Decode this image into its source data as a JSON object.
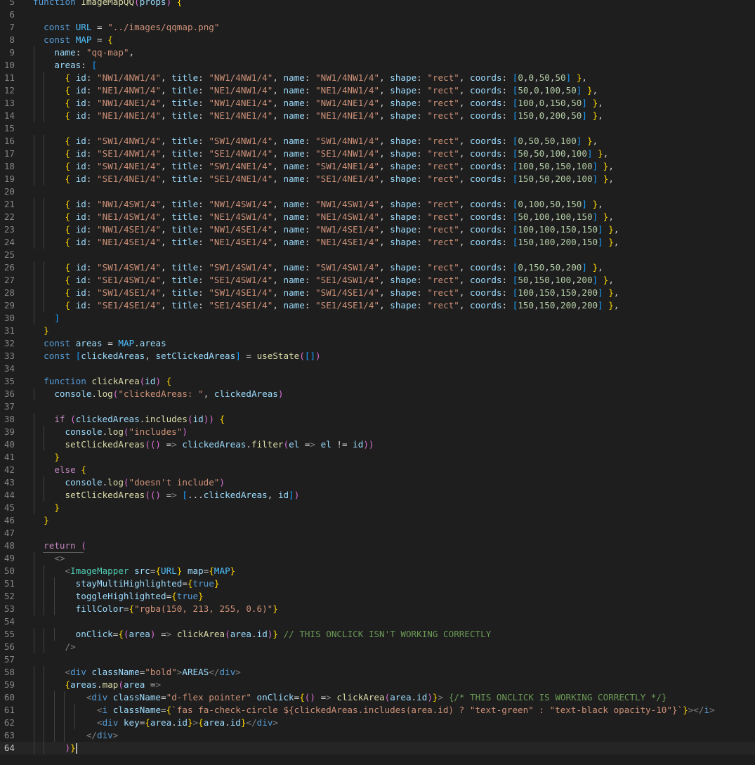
{
  "editor": {
    "language": "javascript-react",
    "current_line": 64,
    "colors": {
      "background": "#1e1e1e",
      "keyword": "#569cd6",
      "control": "#c586c0",
      "function": "#dcdcaa",
      "variable": "#9cdcfe",
      "constant": "#4fc1ff",
      "string": "#ce9178",
      "number": "#b5cea8",
      "comment": "#6a9955",
      "component": "#4ec9b0",
      "line_number": "#858585"
    },
    "lines": [
      {
        "n": "5",
        "text": "function ImageMapQQ(props) {"
      },
      {
        "n": "6",
        "text": ""
      },
      {
        "n": "7",
        "text": "  const URL = \"../images/qqmap.png\""
      },
      {
        "n": "8",
        "text": "  const MAP = {"
      },
      {
        "n": "9",
        "text": "    name: \"qq-map\","
      },
      {
        "n": "10",
        "text": "    areas: ["
      },
      {
        "n": "11",
        "text": "      { id: \"NW1/4NW1/4\", title: \"NW1/4NW1/4\", name: \"NW1/4NW1/4\", shape: \"rect\", coords: [0,0,50,50] },"
      },
      {
        "n": "12",
        "text": "      { id: \"NE1/4NW1/4\", title: \"NE1/4NW1/4\", name: \"NE1/4NW1/4\", shape: \"rect\", coords: [50,0,100,50] },"
      },
      {
        "n": "13",
        "text": "      { id: \"NW1/4NE1/4\", title: \"NW1/4NE1/4\", name: \"NW1/4NE1/4\", shape: \"rect\", coords: [100,0,150,50] },"
      },
      {
        "n": "14",
        "text": "      { id: \"NE1/4NE1/4\", title: \"NE1/4NE1/4\", name: \"NE1/4NE1/4\", shape: \"rect\", coords: [150,0,200,50] },"
      },
      {
        "n": "15",
        "text": ""
      },
      {
        "n": "16",
        "text": "      { id: \"SW1/4NW1/4\", title: \"SW1/4NW1/4\", name: \"SW1/4NW1/4\", shape: \"rect\", coords: [0,50,50,100] },"
      },
      {
        "n": "17",
        "text": "      { id: \"SE1/4NW1/4\", title: \"SE1/4NW1/4\", name: \"SE1/4NW1/4\", shape: \"rect\", coords: [50,50,100,100] },"
      },
      {
        "n": "18",
        "text": "      { id: \"SW1/4NE1/4\", title: \"SW1/4NE1/4\", name: \"SW1/4NE1/4\", shape: \"rect\", coords: [100,50,150,100] },"
      },
      {
        "n": "19",
        "text": "      { id: \"SE1/4NE1/4\", title: \"SE1/4NE1/4\", name: \"SE1/4NE1/4\", shape: \"rect\", coords: [150,50,200,100] },"
      },
      {
        "n": "20",
        "text": ""
      },
      {
        "n": "21",
        "text": "      { id: \"NW1/4SW1/4\", title: \"NW1/4SW1/4\", name: \"NW1/4SW1/4\", shape: \"rect\", coords: [0,100,50,150] },"
      },
      {
        "n": "22",
        "text": "      { id: \"NE1/4SW1/4\", title: \"NE1/4SW1/4\", name: \"NE1/4SW1/4\", shape: \"rect\", coords: [50,100,100,150] },"
      },
      {
        "n": "23",
        "text": "      { id: \"NW1/4SE1/4\", title: \"NW1/4SE1/4\", name: \"NW1/4SE1/4\", shape: \"rect\", coords: [100,100,150,150] },"
      },
      {
        "n": "24",
        "text": "      { id: \"NE1/4SE1/4\", title: \"NE1/4SE1/4\", name: \"NE1/4SE1/4\", shape: \"rect\", coords: [150,100,200,150] },"
      },
      {
        "n": "25",
        "text": ""
      },
      {
        "n": "26",
        "text": "      { id: \"SW1/4SW1/4\", title: \"SW1/4SW1/4\", name: \"SW1/4SW1/4\", shape: \"rect\", coords: [0,150,50,200] },"
      },
      {
        "n": "27",
        "text": "      { id: \"SE1/4SW1/4\", title: \"SE1/4SW1/4\", name: \"SE1/4SW1/4\", shape: \"rect\", coords: [50,150,100,200] },"
      },
      {
        "n": "28",
        "text": "      { id: \"SW1/4SE1/4\", title: \"SW1/4SE1/4\", name: \"SW1/4SE1/4\", shape: \"rect\", coords: [100,150,150,200] },"
      },
      {
        "n": "29",
        "text": "      { id: \"SE1/4SE1/4\", title: \"SE1/4SE1/4\", name: \"SE1/4SE1/4\", shape: \"rect\", coords: [150,150,200,200] },"
      },
      {
        "n": "30",
        "text": "    ]"
      },
      {
        "n": "31",
        "text": "  }"
      },
      {
        "n": "32",
        "text": "  const areas = MAP.areas"
      },
      {
        "n": "33",
        "text": "  const [clickedAreas, setClickedAreas] = useState([])"
      },
      {
        "n": "34",
        "text": ""
      },
      {
        "n": "35",
        "text": "  function clickArea(id) {"
      },
      {
        "n": "36",
        "text": "    console.log(\"clickedAreas: \", clickedAreas)"
      },
      {
        "n": "37",
        "text": ""
      },
      {
        "n": "38",
        "text": "    if (clickedAreas.includes(id)) {"
      },
      {
        "n": "39",
        "text": "      console.log(\"includes\")"
      },
      {
        "n": "40",
        "text": "      setClickedAreas(() => clickedAreas.filter(el => el != id))"
      },
      {
        "n": "41",
        "text": "    }"
      },
      {
        "n": "42",
        "text": "    else {"
      },
      {
        "n": "43",
        "text": "      console.log(\"doesn't include\")"
      },
      {
        "n": "44",
        "text": "      setClickedAreas(() => [...clickedAreas, id])"
      },
      {
        "n": "45",
        "text": "    }"
      },
      {
        "n": "46",
        "text": "  }"
      },
      {
        "n": "47",
        "text": ""
      },
      {
        "n": "48",
        "text": "  return ("
      },
      {
        "n": "49",
        "text": "    <>"
      },
      {
        "n": "50",
        "text": "      <ImageMapper src={URL} map={MAP}"
      },
      {
        "n": "51",
        "text": "        stayMultiHighlighted={true}"
      },
      {
        "n": "52",
        "text": "        toggleHighlighted={true}"
      },
      {
        "n": "53",
        "text": "        fillColor={\"rgba(150, 213, 255, 0.6)\"}"
      },
      {
        "n": "54",
        "text": ""
      },
      {
        "n": "55",
        "text": "        onClick={(area) => clickArea(area.id)} // THIS ONCLICK ISN'T WORKING CORRECTLY"
      },
      {
        "n": "56",
        "text": "      />"
      },
      {
        "n": "57",
        "text": ""
      },
      {
        "n": "58",
        "text": "      <div className=\"bold\">AREAS</div>"
      },
      {
        "n": "59",
        "text": "      {areas.map(area =>"
      },
      {
        "n": "60",
        "text": "          <div className=\"d-flex pointer\" onClick={() => clickArea(area.id)}> {/* THIS ONCLICK IS WORKING CORRECTLY */}"
      },
      {
        "n": "61",
        "text": "            <i className={`fas fa-check-circle ${clickedAreas.includes(area.id) ? \"text-green\" : \"text-black opacity-10\"}`}></i>"
      },
      {
        "n": "62",
        "text": "            <div key={area.id}>{area.id}</div>"
      },
      {
        "n": "63",
        "text": "          </div>"
      },
      {
        "n": "64",
        "text": "      )}"
      }
    ]
  }
}
